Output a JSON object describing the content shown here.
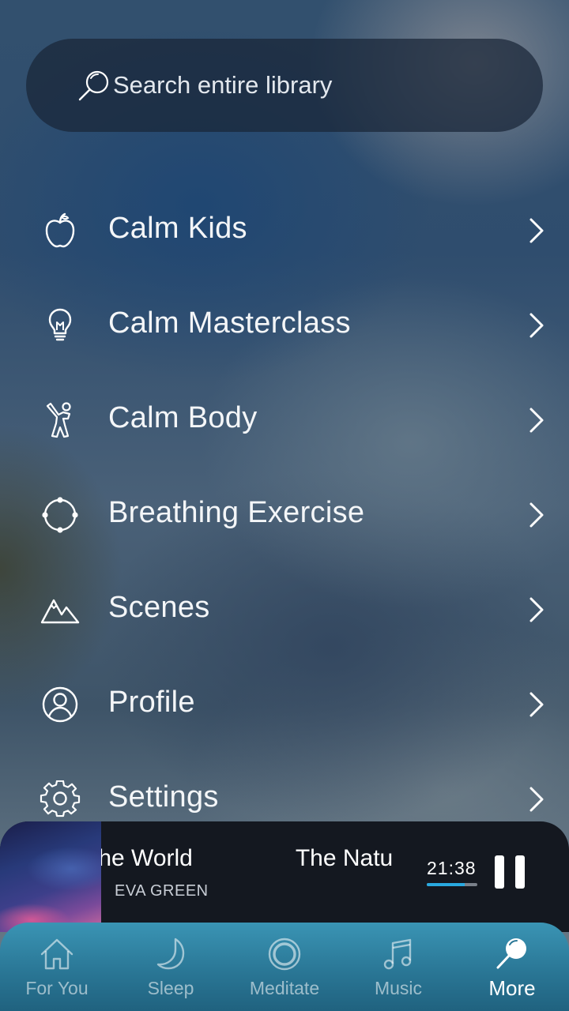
{
  "search": {
    "placeholder": "Search entire library",
    "icon": "search-icon"
  },
  "menu": {
    "items": [
      {
        "label": "Calm Kids",
        "icon": "apple-icon"
      },
      {
        "label": "Calm Masterclass",
        "icon": "lightbulb-icon"
      },
      {
        "label": "Calm Body",
        "icon": "stretching-person-icon"
      },
      {
        "label": "Breathing Exercise",
        "icon": "breathing-circle-icon"
      },
      {
        "label": "Scenes",
        "icon": "mountains-icon"
      },
      {
        "label": "Profile",
        "icon": "user-circle-icon"
      },
      {
        "label": "Settings",
        "icon": "gear-icon"
      }
    ]
  },
  "player": {
    "title_fragment_1": "the World",
    "title_fragment_2": "The Natu",
    "artist": "EVA GREEN",
    "time": "21:38",
    "progress_fraction": 0.75,
    "accent_color": "#29a9e0"
  },
  "tabs": [
    {
      "label": "For You",
      "icon": "house-icon",
      "active": false
    },
    {
      "label": "Sleep",
      "icon": "moon-icon",
      "active": false
    },
    {
      "label": "Meditate",
      "icon": "meditate-ring-icon",
      "active": false
    },
    {
      "label": "Music",
      "icon": "music-note-icon",
      "active": false
    },
    {
      "label": "More",
      "icon": "search-icon",
      "active": true
    }
  ]
}
